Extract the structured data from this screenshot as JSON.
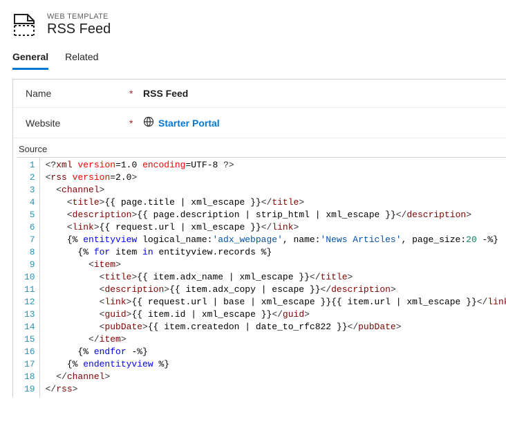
{
  "header": {
    "eyebrow": "WEB TEMPLATE",
    "title": "RSS Feed"
  },
  "tabs": [
    {
      "label": "General",
      "active": true
    },
    {
      "label": "Related",
      "active": false
    }
  ],
  "fields": {
    "name": {
      "label": "Name",
      "value": "RSS Feed"
    },
    "website": {
      "label": "Website",
      "value": "Starter Portal"
    }
  },
  "source": {
    "label": "Source",
    "lines": [
      [
        {
          "c": "t-del",
          "t": "<?"
        },
        {
          "c": "t-tag",
          "t": "xml"
        },
        {
          "c": "t-plain",
          "t": " "
        },
        {
          "c": "t-attr",
          "t": "version"
        },
        {
          "c": "t-plain",
          "t": "=1.0 "
        },
        {
          "c": "t-attr",
          "t": "encoding"
        },
        {
          "c": "t-plain",
          "t": "=UTF-8 "
        },
        {
          "c": "t-del",
          "t": "?>"
        }
      ],
      [
        {
          "c": "t-del",
          "t": "<"
        },
        {
          "c": "t-tag",
          "t": "rss"
        },
        {
          "c": "t-plain",
          "t": " "
        },
        {
          "c": "t-attr",
          "t": "version"
        },
        {
          "c": "t-plain",
          "t": "=2.0"
        },
        {
          "c": "t-del",
          "t": ">"
        }
      ],
      [
        {
          "c": "t-plain",
          "t": "  "
        },
        {
          "c": "t-del",
          "t": "<"
        },
        {
          "c": "t-tag",
          "t": "channel"
        },
        {
          "c": "t-del",
          "t": ">"
        }
      ],
      [
        {
          "c": "t-plain",
          "t": "    "
        },
        {
          "c": "t-del",
          "t": "<"
        },
        {
          "c": "t-tag",
          "t": "title"
        },
        {
          "c": "t-del",
          "t": ">"
        },
        {
          "c": "t-plain",
          "t": "{{ page.title | xml_escape }}"
        },
        {
          "c": "t-del",
          "t": "</"
        },
        {
          "c": "t-tag",
          "t": "title"
        },
        {
          "c": "t-del",
          "t": ">"
        }
      ],
      [
        {
          "c": "t-plain",
          "t": "    "
        },
        {
          "c": "t-del",
          "t": "<"
        },
        {
          "c": "t-tag",
          "t": "description"
        },
        {
          "c": "t-del",
          "t": ">"
        },
        {
          "c": "t-plain",
          "t": "{{ page.description | strip_html | xml_escape }}"
        },
        {
          "c": "t-del",
          "t": "</"
        },
        {
          "c": "t-tag",
          "t": "description"
        },
        {
          "c": "t-del",
          "t": ">"
        }
      ],
      [
        {
          "c": "t-plain",
          "t": "    "
        },
        {
          "c": "t-del",
          "t": "<"
        },
        {
          "c": "t-tag",
          "t": "link"
        },
        {
          "c": "t-del",
          "t": ">"
        },
        {
          "c": "t-plain",
          "t": "{{ request.url | xml_escape }}"
        },
        {
          "c": "t-del",
          "t": "</"
        },
        {
          "c": "t-tag",
          "t": "link"
        },
        {
          "c": "t-del",
          "t": ">"
        }
      ],
      [
        {
          "c": "t-plain",
          "t": "    {% "
        },
        {
          "c": "t-kw",
          "t": "entityview"
        },
        {
          "c": "t-plain",
          "t": " logical_name:"
        },
        {
          "c": "t-str",
          "t": "'adx_webpage'"
        },
        {
          "c": "t-plain",
          "t": ", name:"
        },
        {
          "c": "t-str",
          "t": "'News Articles'"
        },
        {
          "c": "t-plain",
          "t": ", page_size:"
        },
        {
          "c": "t-num",
          "t": "20"
        },
        {
          "c": "t-plain",
          "t": " -%}"
        }
      ],
      [
        {
          "c": "t-plain",
          "t": "      {% "
        },
        {
          "c": "t-kw",
          "t": "for"
        },
        {
          "c": "t-plain",
          "t": " item "
        },
        {
          "c": "t-kw",
          "t": "in"
        },
        {
          "c": "t-plain",
          "t": " entityview.records %}"
        }
      ],
      [
        {
          "c": "t-plain",
          "t": "        "
        },
        {
          "c": "t-del",
          "t": "<"
        },
        {
          "c": "t-tag",
          "t": "item"
        },
        {
          "c": "t-del",
          "t": ">"
        }
      ],
      [
        {
          "c": "t-plain",
          "t": "          "
        },
        {
          "c": "t-del",
          "t": "<"
        },
        {
          "c": "t-tag",
          "t": "title"
        },
        {
          "c": "t-del",
          "t": ">"
        },
        {
          "c": "t-plain",
          "t": "{{ item.adx_name | xml_escape }}"
        },
        {
          "c": "t-del",
          "t": "</"
        },
        {
          "c": "t-tag",
          "t": "title"
        },
        {
          "c": "t-del",
          "t": ">"
        }
      ],
      [
        {
          "c": "t-plain",
          "t": "          "
        },
        {
          "c": "t-del",
          "t": "<"
        },
        {
          "c": "t-tag",
          "t": "description"
        },
        {
          "c": "t-del",
          "t": ">"
        },
        {
          "c": "t-plain",
          "t": "{{ item.adx_copy | escape }}"
        },
        {
          "c": "t-del",
          "t": "</"
        },
        {
          "c": "t-tag",
          "t": "description"
        },
        {
          "c": "t-del",
          "t": ">"
        }
      ],
      [
        {
          "c": "t-plain",
          "t": "          "
        },
        {
          "c": "t-del",
          "t": "<"
        },
        {
          "c": "t-tag",
          "t": "link"
        },
        {
          "c": "t-del",
          "t": ">"
        },
        {
          "c": "t-plain",
          "t": "{{ request.url | base | xml_escape }}{{ item.url | xml_escape }}"
        },
        {
          "c": "t-del",
          "t": "</"
        },
        {
          "c": "t-tag",
          "t": "link"
        },
        {
          "c": "t-del",
          "t": ">"
        }
      ],
      [
        {
          "c": "t-plain",
          "t": "          "
        },
        {
          "c": "t-del",
          "t": "<"
        },
        {
          "c": "t-tag",
          "t": "guid"
        },
        {
          "c": "t-del",
          "t": ">"
        },
        {
          "c": "t-plain",
          "t": "{{ item.id | xml_escape }}"
        },
        {
          "c": "t-del",
          "t": "</"
        },
        {
          "c": "t-tag",
          "t": "guid"
        },
        {
          "c": "t-del",
          "t": ">"
        }
      ],
      [
        {
          "c": "t-plain",
          "t": "          "
        },
        {
          "c": "t-del",
          "t": "<"
        },
        {
          "c": "t-tag",
          "t": "pubDate"
        },
        {
          "c": "t-del",
          "t": ">"
        },
        {
          "c": "t-plain",
          "t": "{{ item.createdon | date_to_rfc822 }}"
        },
        {
          "c": "t-del",
          "t": "</"
        },
        {
          "c": "t-tag",
          "t": "pubDate"
        },
        {
          "c": "t-del",
          "t": ">"
        }
      ],
      [
        {
          "c": "t-plain",
          "t": "        "
        },
        {
          "c": "t-del",
          "t": "</"
        },
        {
          "c": "t-tag",
          "t": "item"
        },
        {
          "c": "t-del",
          "t": ">"
        }
      ],
      [
        {
          "c": "t-plain",
          "t": "      {% "
        },
        {
          "c": "t-kw",
          "t": "endfor"
        },
        {
          "c": "t-plain",
          "t": " -%}"
        }
      ],
      [
        {
          "c": "t-plain",
          "t": "    {% "
        },
        {
          "c": "t-kw",
          "t": "endentityview"
        },
        {
          "c": "t-plain",
          "t": " %}"
        }
      ],
      [
        {
          "c": "t-plain",
          "t": "  "
        },
        {
          "c": "t-del",
          "t": "</"
        },
        {
          "c": "t-tag",
          "t": "channel"
        },
        {
          "c": "t-del",
          "t": ">"
        }
      ],
      [
        {
          "c": "t-del",
          "t": "</"
        },
        {
          "c": "t-tag",
          "t": "rss"
        },
        {
          "c": "t-del",
          "t": ">"
        }
      ]
    ]
  }
}
